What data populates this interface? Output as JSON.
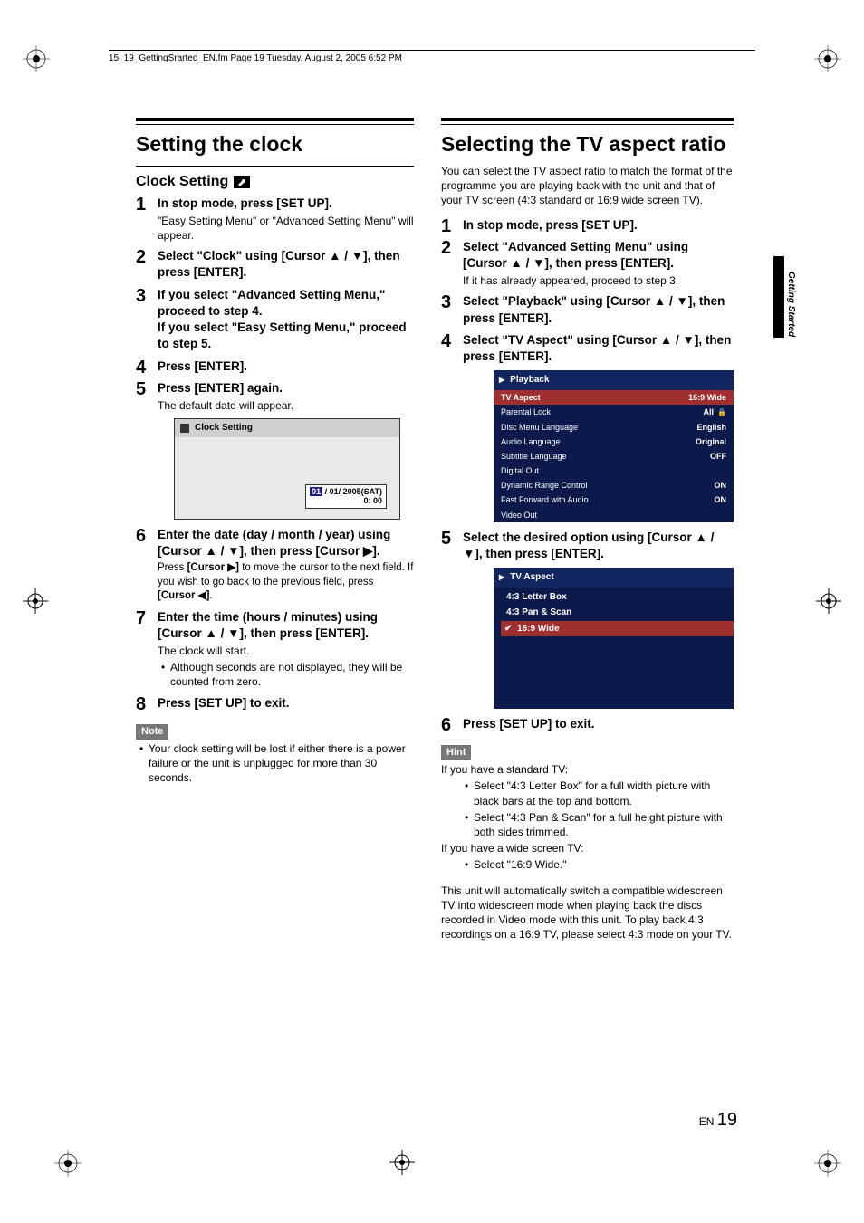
{
  "header_line": "15_19_GettingSrarted_EN.fm  Page 19  Tuesday, August 2, 2005  6:52 PM",
  "side_tab_label": "Getting Started",
  "page_lang": "EN",
  "page_number": "19",
  "left": {
    "title": "Setting the clock",
    "subtitle": "Clock Setting",
    "steps": [
      {
        "title": "In stop mode, press [SET UP].",
        "body": "\"Easy Setting Menu\" or \"Advanced Setting Menu\" will appear."
      },
      {
        "title": "Select \"Clock\" using [Cursor ▲ / ▼], then press [ENTER]."
      },
      {
        "title": "If you select \"Advanced Setting Menu,\" proceed to step 4.\nIf you select \"Easy Setting Menu,\" proceed to step 5."
      },
      {
        "title": "Press [ENTER]."
      },
      {
        "title": "Press [ENTER] again.",
        "body": "The default date will appear."
      },
      {
        "title": "Enter the date (day / month / year) using [Cursor ▲ / ▼], then press [Cursor ▶].",
        "body_parts": [
          "Press ",
          "[Cursor ▶]",
          " to move the cursor to the next field. If you wish to go back to the previous field, press ",
          "[Cursor ◀]",
          "."
        ]
      },
      {
        "title": "Enter the time (hours / minutes) using [Cursor ▲ / ▼], then press [ENTER].",
        "body": "The clock will start.",
        "bullets": [
          "Although seconds are not displayed, they will be counted from zero."
        ]
      },
      {
        "title": "Press [SET UP] to exit."
      }
    ],
    "clock_screen": {
      "title": "Clock Setting",
      "date_sel": "01",
      "date_rest": " / 01/ 2005(SAT)",
      "time": "0: 00"
    },
    "note_label": "Note",
    "notes": [
      "Your clock setting will be lost if either there is a power failure or the unit is unplugged for more than 30 seconds."
    ]
  },
  "right": {
    "title": "Selecting the TV aspect ratio",
    "intro": "You can select the TV aspect ratio to match the format of the programme you are playing back with the unit and that of your TV screen (4:3 standard or 16:9 wide screen TV).",
    "steps": [
      {
        "title": "In stop mode, press [SET UP]."
      },
      {
        "title": "Select \"Advanced Setting Menu\" using [Cursor ▲ / ▼], then press [ENTER].",
        "body": "If it has already appeared, proceed to step 3."
      },
      {
        "title": "Select \"Playback\" using [Cursor ▲ / ▼], then press [ENTER]."
      },
      {
        "title": "Select \"TV Aspect\" using [Cursor ▲ / ▼], then press [ENTER]."
      },
      {
        "title": "Select the desired option using [Cursor ▲ / ▼], then press [ENTER]."
      },
      {
        "title": "Press [SET UP] to exit."
      }
    ],
    "playback_menu": {
      "title": "Playback",
      "rows": [
        {
          "label": "TV Aspect",
          "value": "16:9 Wide",
          "selected": true
        },
        {
          "label": "Parental Lock",
          "value": "All",
          "lock": true
        },
        {
          "label": "Disc Menu Language",
          "value": "English"
        },
        {
          "label": "Audio Language",
          "value": "Original"
        },
        {
          "label": "Subtitle Language",
          "value": "OFF"
        },
        {
          "label": "Digital Out",
          "value": ""
        },
        {
          "label": "Dynamic Range Control",
          "value": "ON"
        },
        {
          "label": "Fast Forward with Audio",
          "value": "ON"
        },
        {
          "label": "Video Out",
          "value": ""
        }
      ]
    },
    "aspect_menu": {
      "title": "TV Aspect",
      "items": [
        {
          "label": "4:3 Letter Box"
        },
        {
          "label": "4:3 Pan & Scan"
        },
        {
          "label": "16:9 Wide",
          "selected": true
        }
      ]
    },
    "hint_label": "Hint",
    "hint_intro1": "If you have a standard TV:",
    "hint_bullets1": [
      "Select \"4:3 Letter Box\" for a full width picture with black bars at the top and bottom.",
      "Select \"4:3 Pan & Scan\" for a full height picture with both sides trimmed."
    ],
    "hint_intro2": "If you have a wide screen TV:",
    "hint_bullets2": [
      "Select \"16:9 Wide.\""
    ],
    "hint_para": "This unit will automatically switch a compatible widescreen TV into widescreen mode when playing back the discs recorded in Video mode with this unit. To play back 4:3 recordings on a 16:9 TV, please select 4:3 mode on your TV."
  }
}
